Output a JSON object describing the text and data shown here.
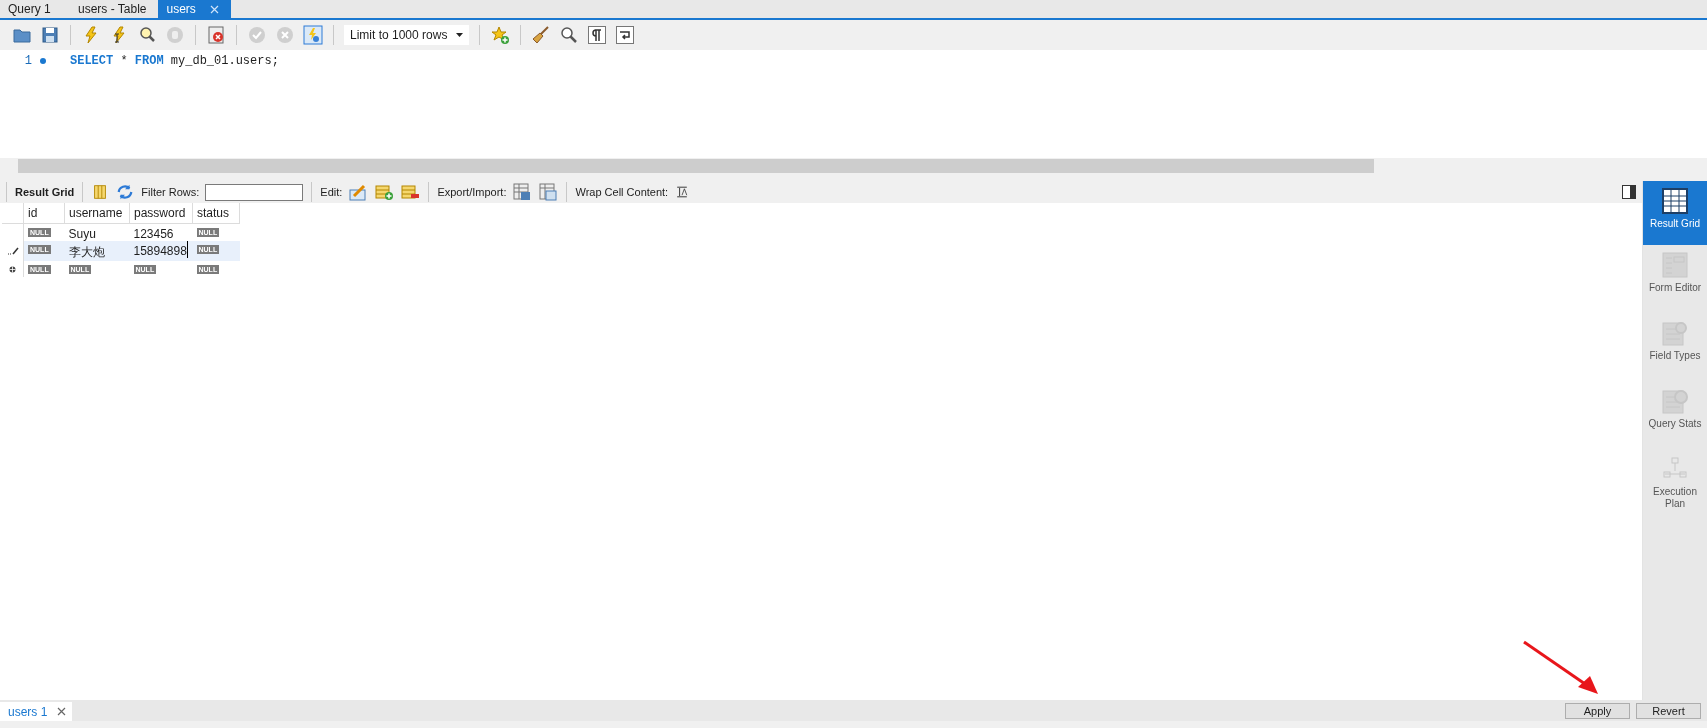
{
  "tabs": [
    {
      "label": "Query 1",
      "selected": false,
      "closable": false
    },
    {
      "label": "users - Table",
      "selected": false,
      "closable": false
    },
    {
      "label": "users",
      "selected": true,
      "closable": true
    }
  ],
  "toolbar": {
    "limit": "Limit to 1000 rows"
  },
  "editor": {
    "lines": [
      {
        "number": "1",
        "tokens": [
          {
            "kind": "keyword",
            "text": "SELECT"
          },
          {
            "kind": "plain",
            "text": " * "
          },
          {
            "kind": "keyword",
            "text": "FROM"
          },
          {
            "kind": "plain",
            "text": " my_db_01.users;"
          }
        ]
      }
    ]
  },
  "result_toolbar": {
    "title": "Result Grid",
    "filter_label": "Filter Rows:",
    "edit_label": "Edit:",
    "export_label": "Export/Import:",
    "wrap_label": "Wrap Cell Content:"
  },
  "table": {
    "columns": [
      "id",
      "username",
      "password",
      "status"
    ],
    "rows": [
      {
        "kind": "normal",
        "selected": false,
        "cells": [
          {
            "kind": "null",
            "text": "NULL"
          },
          {
            "kind": "value",
            "text": "Suyu"
          },
          {
            "kind": "value",
            "text": "123456"
          },
          {
            "kind": "null",
            "text": "NULL"
          }
        ]
      },
      {
        "kind": "edited",
        "selected": true,
        "cells": [
          {
            "kind": "null",
            "text": "NULL"
          },
          {
            "kind": "value",
            "text": "李大炮"
          },
          {
            "kind": "value",
            "text": "15894898",
            "editing": true
          },
          {
            "kind": "null",
            "text": "NULL"
          }
        ]
      },
      {
        "kind": "new",
        "selected": false,
        "cells": [
          {
            "kind": "null",
            "text": "NULL"
          },
          {
            "kind": "null",
            "text": "NULL"
          },
          {
            "kind": "null",
            "text": "NULL"
          },
          {
            "kind": "null",
            "text": "NULL"
          }
        ]
      }
    ]
  },
  "side_panel": [
    {
      "kind": "grid",
      "label": "Result Grid",
      "selected": true
    },
    {
      "kind": "form",
      "label": "Form Editor",
      "selected": false
    },
    {
      "kind": "types",
      "label": "Field Types",
      "selected": false
    },
    {
      "kind": "stats",
      "label": "Query Stats",
      "selected": false
    },
    {
      "kind": "plan",
      "label": "Execution Plan",
      "selected": false
    }
  ],
  "result_tabs": [
    {
      "label": "users 1",
      "selected": true
    }
  ],
  "buttons": [
    {
      "label": "Apply"
    },
    {
      "label": "Revert"
    }
  ]
}
